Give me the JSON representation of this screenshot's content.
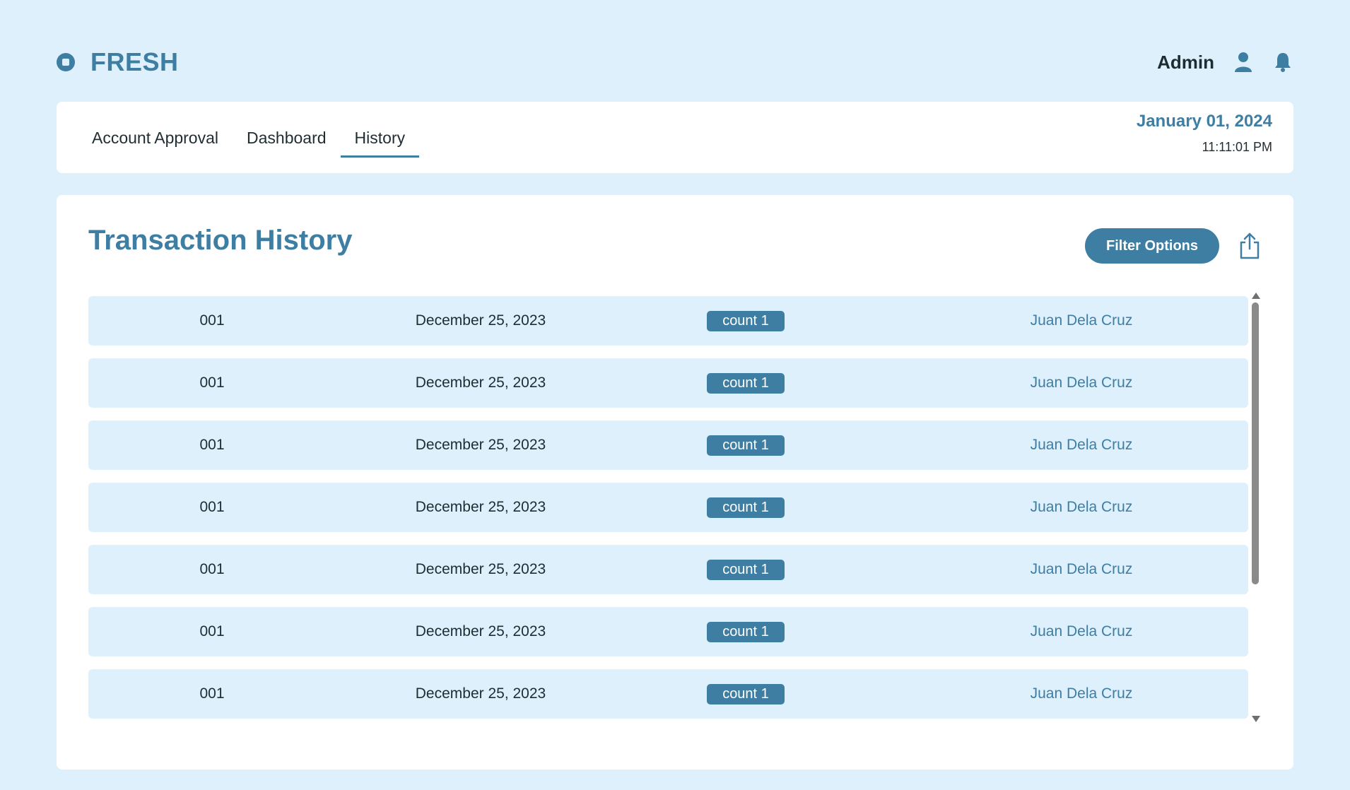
{
  "header": {
    "brand": "FRESH",
    "user_label": "Admin"
  },
  "nav": {
    "tabs": [
      {
        "label": "Account Approval",
        "active": false
      },
      {
        "label": "Dashboard",
        "active": false
      },
      {
        "label": "History",
        "active": true
      }
    ],
    "date": "January 01, 2024",
    "time": "11:11:01 PM"
  },
  "main": {
    "title": "Transaction History",
    "filter_label": "Filter Options",
    "rows": [
      {
        "id": "001",
        "date": "December 25, 2023",
        "badge": "count 1",
        "name": "Juan Dela Cruz"
      },
      {
        "id": "001",
        "date": "December 25, 2023",
        "badge": "count 1",
        "name": "Juan Dela Cruz"
      },
      {
        "id": "001",
        "date": "December 25, 2023",
        "badge": "count 1",
        "name": "Juan Dela Cruz"
      },
      {
        "id": "001",
        "date": "December 25, 2023",
        "badge": "count 1",
        "name": "Juan Dela Cruz"
      },
      {
        "id": "001",
        "date": "December 25, 2023",
        "badge": "count 1",
        "name": "Juan Dela Cruz"
      },
      {
        "id": "001",
        "date": "December 25, 2023",
        "badge": "count 1",
        "name": "Juan Dela Cruz"
      },
      {
        "id": "001",
        "date": "December 25, 2023",
        "badge": "count 1",
        "name": "Juan Dela Cruz"
      }
    ]
  },
  "icons": {
    "logo": "circle-logo-icon",
    "user": "user-icon",
    "notifications": "bell-icon",
    "export": "share-export-icon"
  },
  "colors": {
    "background": "#ddf0fb",
    "accent": "#3e7ea3",
    "card": "#ffffff"
  }
}
